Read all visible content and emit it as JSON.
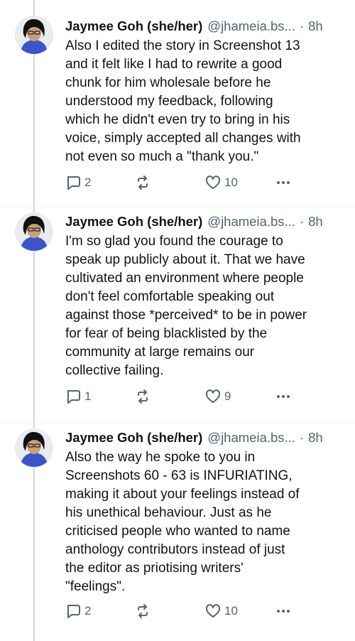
{
  "tweets": [
    {
      "name": "Jaymee Goh (she/her)",
      "handle": "@jhameia.bs...",
      "dot": "·",
      "time": "8h",
      "lines": [
        "Also I edited the story in Screenshot 13",
        "and it felt like I had to rewrite a good",
        "chunk for him wholesale before he",
        "understood my feedback, following",
        "which he didn't even try to bring in his",
        "voice, simply accepted all changes with",
        "not even so much a \"thank you.\""
      ],
      "replies": "2",
      "likes": "10"
    },
    {
      "name": "Jaymee Goh (she/her)",
      "handle": "@jhameia.bs...",
      "dot": "·",
      "time": "8h",
      "lines": [
        "I'm so glad you found the courage to",
        "speak up publicly about it. That we have",
        "cultivated an environment where people",
        "don't feel comfortable speaking out",
        "against those *perceived* to be in power",
        "for fear of being blacklisted by the",
        "community at large remains our",
        "collective failing."
      ],
      "replies": "1",
      "likes": "9"
    },
    {
      "name": "Jaymee Goh (she/her)",
      "handle": "@jhameia.bs...",
      "dot": "·",
      "time": "8h",
      "lines": [
        "Also the way he spoke to you in",
        "Screenshots 60 - 63 is INFURIATING,",
        "making it about your feelings instead of",
        "his unethical behaviour. Just as he",
        "criticised people who wanted to name",
        "anthology contributors instead of just",
        "the editor as priotising writers'",
        "\"feelings\"."
      ],
      "replies": "2",
      "likes": "10"
    }
  ],
  "icons": {
    "reply": "reply-icon",
    "repost": "repost-icon",
    "like": "heart-icon",
    "more": "more-icon"
  },
  "colors": {
    "text": "#0f1419",
    "secondary": "#536471",
    "thread_line": "#cfd9de"
  }
}
